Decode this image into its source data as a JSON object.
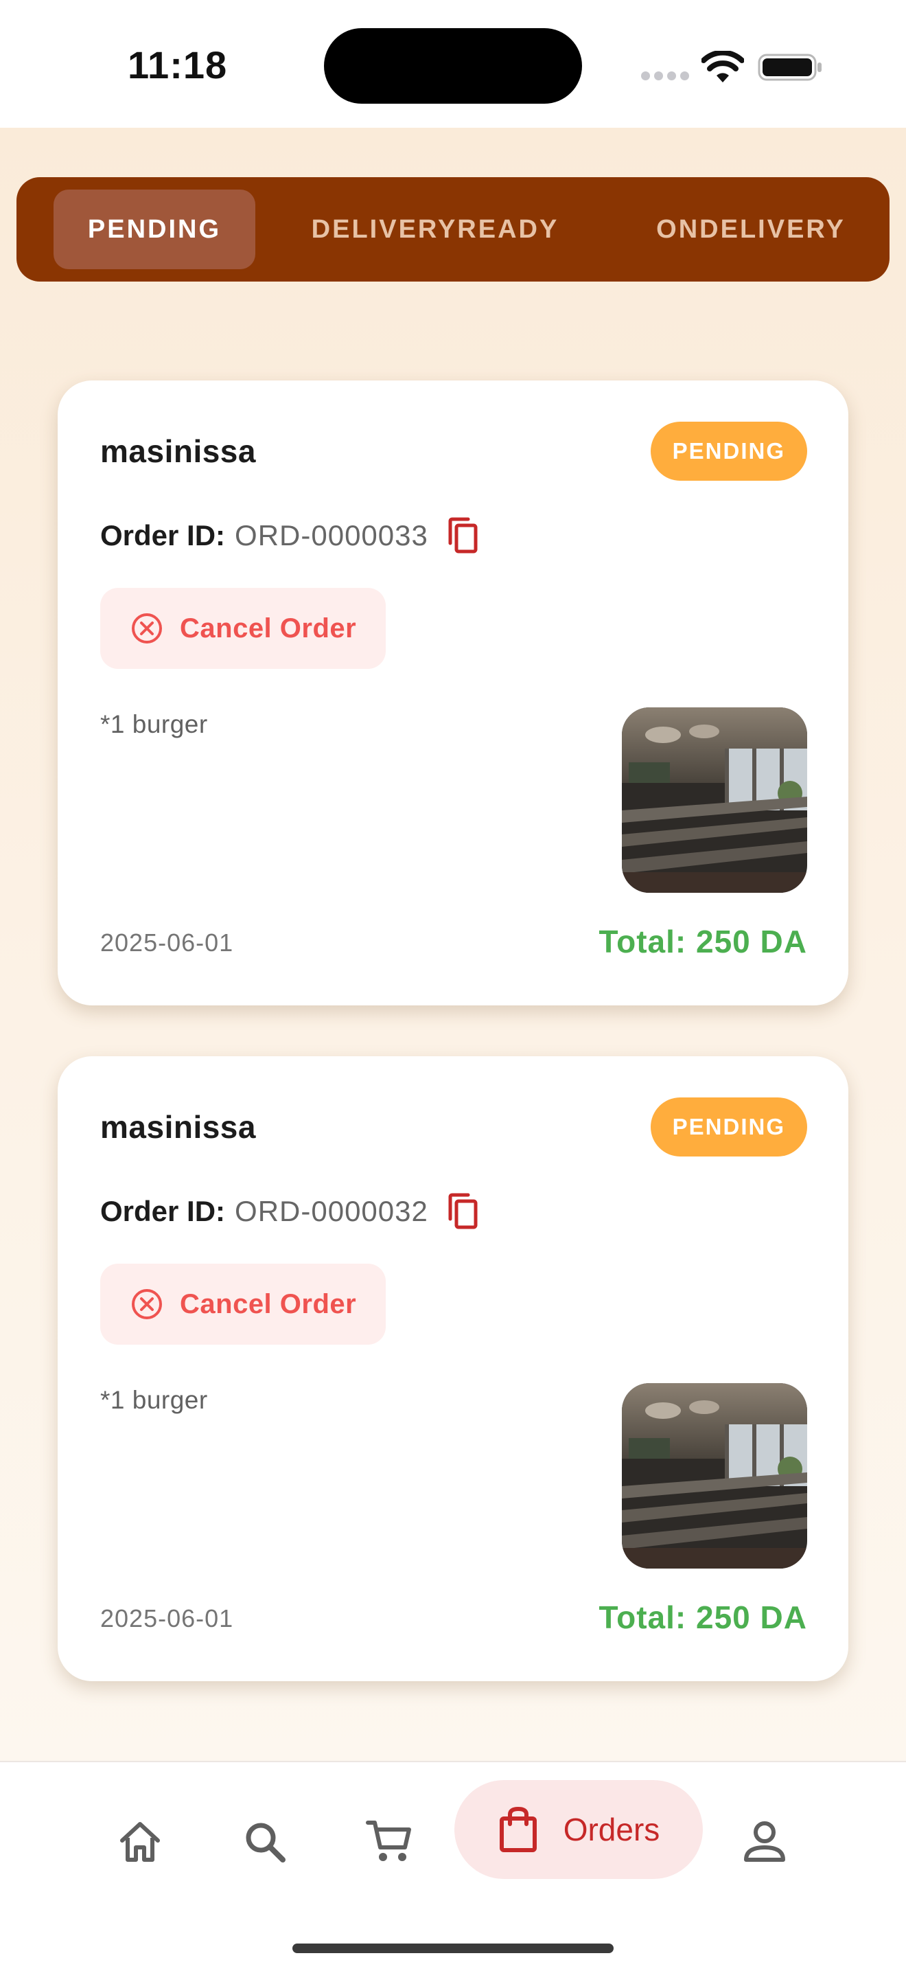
{
  "status_bar": {
    "time": "11:18"
  },
  "tabs": [
    {
      "label": "PENDING",
      "active": true
    },
    {
      "label": "DELIVERYREADY",
      "active": false
    },
    {
      "label": "ONDELIVERY",
      "active": false
    }
  ],
  "orders": [
    {
      "customer": "masinissa",
      "status": "PENDING",
      "order_id_label": "Order ID:",
      "order_id": "ORD-0000033",
      "cancel_label": "Cancel Order",
      "items": "*1 burger",
      "date": "2025-06-01",
      "total": "Total: 250 DA"
    },
    {
      "customer": "masinissa",
      "status": "PENDING",
      "order_id_label": "Order ID:",
      "order_id": "ORD-0000032",
      "cancel_label": "Cancel Order",
      "items": "*1 burger",
      "date": "2025-06-01",
      "total": "Total: 250 DA"
    }
  ],
  "bottom_nav": {
    "items": [
      {
        "icon": "home-icon"
      },
      {
        "icon": "search-icon"
      },
      {
        "icon": "cart-icon"
      },
      {
        "icon": "shopping-bag-icon",
        "label": "Orders",
        "active": true
      },
      {
        "icon": "person-icon"
      }
    ]
  },
  "colors": {
    "tab_bar": "#8a3502",
    "badge": "#ffad3d",
    "cancel": "#ef5350",
    "total": "#4caf50",
    "nav_active": "#c62828"
  }
}
